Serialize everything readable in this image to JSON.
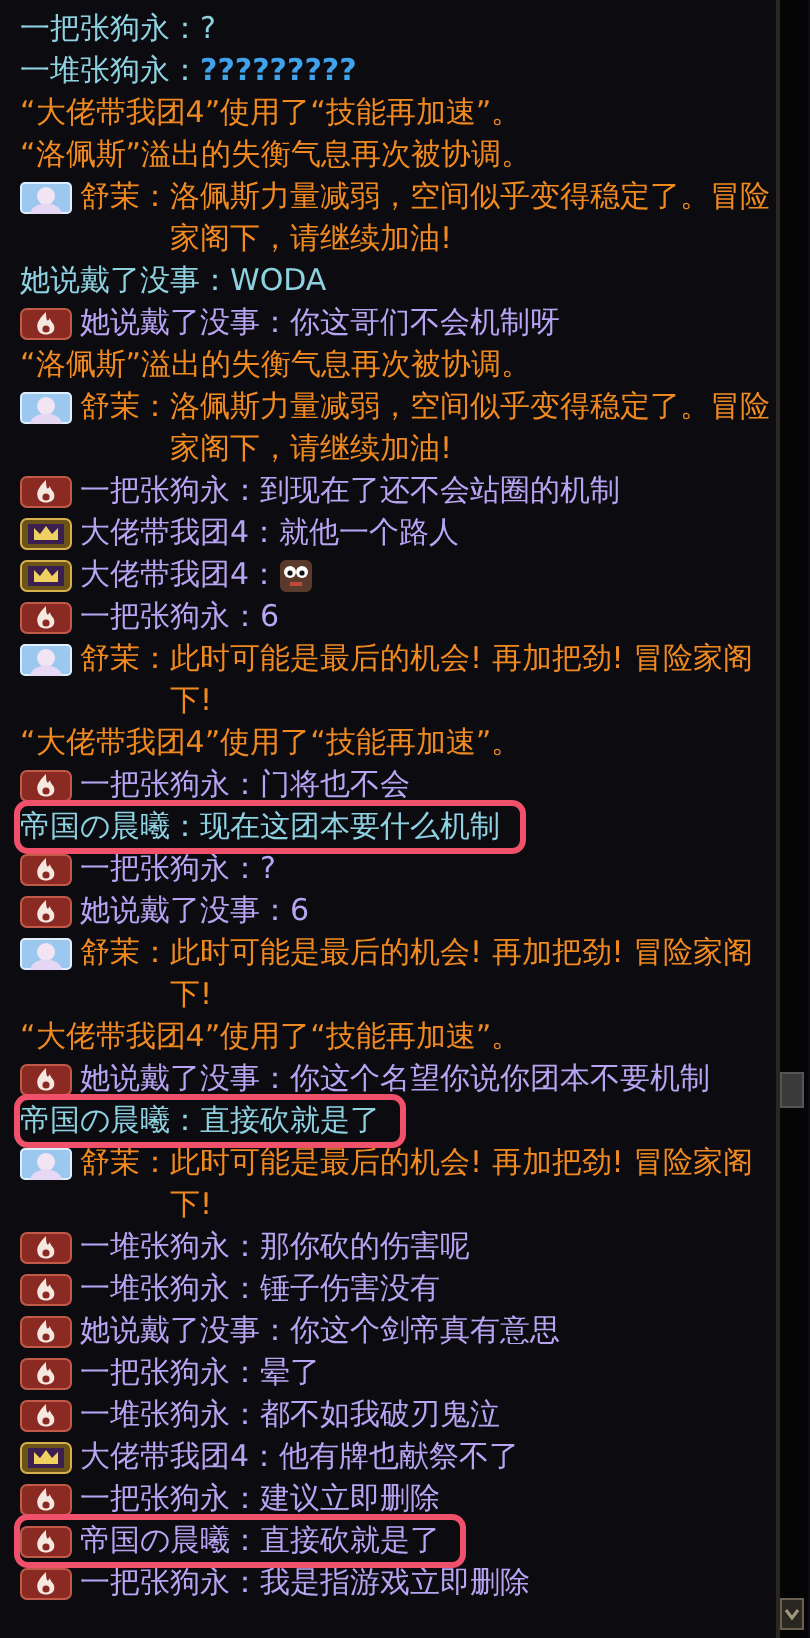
{
  "messages": [
    {
      "kind": "plain",
      "speaker": "一把张狗永：",
      "text": "?",
      "highlighted": false
    },
    {
      "kind": "plain",
      "speaker": "一堆张狗永：",
      "text": "?????????",
      "highlighted": false
    },
    {
      "kind": "system",
      "text": "“大佬带我团4”使用了“技能再加速”。",
      "highlighted": false
    },
    {
      "kind": "system",
      "text": "“洛佩斯”溢出的失衡气息再次被协调。",
      "highlighted": false
    },
    {
      "kind": "npc",
      "speaker": "舒茉：",
      "text": "洛佩斯力量减弱，空间似乎变得稳定了。冒险家阁下，请继续加油!",
      "highlighted": false
    },
    {
      "kind": "plain",
      "speaker": "她说戴了没事：",
      "text": "WODA",
      "highlighted": false
    },
    {
      "kind": "flame",
      "speaker": "她说戴了没事：",
      "text": "你这哥们不会机制呀",
      "highlighted": false
    },
    {
      "kind": "system",
      "text": "“洛佩斯”溢出的失衡气息再次被协调。",
      "highlighted": false
    },
    {
      "kind": "npc",
      "speaker": "舒茉：",
      "text": "洛佩斯力量减弱，空间似乎变得稳定了。冒险家阁下，请继续加油!",
      "highlighted": false
    },
    {
      "kind": "flame",
      "speaker": "一把张狗永：",
      "text": "到现在了还不会站圈的机制",
      "highlighted": false
    },
    {
      "kind": "crown",
      "speaker": "大佬带我团4：",
      "text": "就他一个路人",
      "highlighted": false
    },
    {
      "kind": "crown",
      "speaker": "大佬带我团4：",
      "sticker": true,
      "highlighted": false
    },
    {
      "kind": "flame",
      "speaker": "一把张狗永：",
      "text": "6",
      "highlighted": false
    },
    {
      "kind": "npc",
      "speaker": "舒茉：",
      "text": "此时可能是最后的机会! 再加把劲! 冒险家阁下!",
      "highlighted": false
    },
    {
      "kind": "system",
      "text": "“大佬带我团4”使用了“技能再加速”。",
      "highlighted": false
    },
    {
      "kind": "flame",
      "speaker": "一把张狗永：",
      "text": "门将也不会",
      "highlighted": false
    },
    {
      "kind": "plain",
      "speaker": "帝国の晨曦：",
      "text": "现在这团本要什么机制",
      "highlighted": true
    },
    {
      "kind": "flame",
      "speaker": "一把张狗永：",
      "text": "?",
      "highlighted": false
    },
    {
      "kind": "flame",
      "speaker": "她说戴了没事：",
      "text": "6",
      "highlighted": false
    },
    {
      "kind": "npc",
      "speaker": "舒茉：",
      "text": "此时可能是最后的机会! 再加把劲! 冒险家阁下!",
      "highlighted": false
    },
    {
      "kind": "system",
      "text": "“大佬带我团4”使用了“技能再加速”。",
      "highlighted": false
    },
    {
      "kind": "flame",
      "speaker": "她说戴了没事：",
      "text": "你这个名望你说你团本不要机制",
      "highlighted": false
    },
    {
      "kind": "plain",
      "speaker": "帝国の晨曦：",
      "text": "直接砍就是了",
      "highlighted": true
    },
    {
      "kind": "npc",
      "speaker": "舒茉：",
      "text": "此时可能是最后的机会! 再加把劲! 冒险家阁下!",
      "highlighted": false
    },
    {
      "kind": "flame",
      "speaker": "一堆张狗永：",
      "text": "那你砍的伤害呢",
      "highlighted": false
    },
    {
      "kind": "flame",
      "speaker": "一堆张狗永：",
      "text": "锤子伤害没有",
      "highlighted": false
    },
    {
      "kind": "flame",
      "speaker": "她说戴了没事：",
      "text": "你这个剑帝真有意思",
      "highlighted": false
    },
    {
      "kind": "flame",
      "speaker": "一把张狗永：",
      "text": "晕了",
      "highlighted": false
    },
    {
      "kind": "flame",
      "speaker": "一堆张狗永：",
      "text": "都不如我破刃鬼泣",
      "highlighted": false
    },
    {
      "kind": "crown",
      "speaker": "大佬带我团4：",
      "text": "他有牌也献祭不了",
      "highlighted": false
    },
    {
      "kind": "flame",
      "speaker": "一把张狗永：",
      "text": "建议立即删除",
      "highlighted": false
    },
    {
      "kind": "flame",
      "speaker": "帝国の晨曦：",
      "text": "直接砍就是了",
      "highlighted": true
    },
    {
      "kind": "flame",
      "speaker": "一把张狗永：",
      "text": "我是指游戏立即删除",
      "highlighted": false
    }
  ]
}
